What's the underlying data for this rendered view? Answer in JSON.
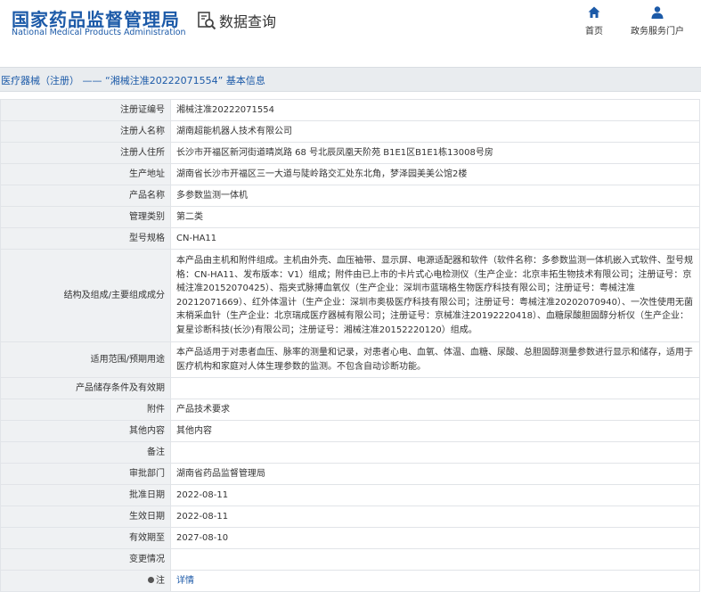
{
  "header": {
    "logo_cn": "国家药品监督管理局",
    "logo_en": "National Medical Products Administration",
    "query_title": "数据查询",
    "nav": [
      {
        "label": "首页",
        "icon": "home-icon"
      },
      {
        "label": "政务服务门户",
        "icon": "user-icon"
      }
    ]
  },
  "breadcrumb": "医疗器械（注册） —— “湘械注准20222071554” 基本信息",
  "colors": {
    "brand": "#1c5aa8",
    "label_bg": "#eff1f3",
    "bar_bg": "#e9ecef"
  },
  "rows": [
    {
      "label": "注册证编号",
      "value": "湘械注准20222071554"
    },
    {
      "label": "注册人名称",
      "value": "湖南超能机器人技术有限公司"
    },
    {
      "label": "注册人住所",
      "value": "长沙市开福区新河街道晴岚路 68 号北辰凤凰天阶苑 B1E1区B1E1栋13008号房"
    },
    {
      "label": "生产地址",
      "value": "湖南省长沙市开福区三一大道与陡岭路交汇处东北角，梦泽园美美公馆2楼"
    },
    {
      "label": "产品名称",
      "value": "多参数监测一体机"
    },
    {
      "label": "管理类别",
      "value": "第二类"
    },
    {
      "label": "型号规格",
      "value": "CN-HA11"
    },
    {
      "label": "结构及组成/主要组成成分",
      "value": "本产品由主机和附件组成。主机由外壳、血压袖带、显示屏、电源适配器和软件（软件名称：多参数监测一体机嵌入式软件、型号规格：CN-HA11、发布版本：V1）组成；附件由已上市的卡片式心电检测仪（生产企业：北京丰拓生物技术有限公司；注册证号：京械注准20152070425）、指夹式脉搏血氧仪（生产企业：深圳市蓝瑞格生物医疗科技有限公司；注册证号：粤械注准20212071669）、红外体温计（生产企业：深圳市奥极医疗科技有限公司；注册证号：粤械注准20202070940）、一次性使用无菌末梢采血针（生产企业：北京瑞成医疗器械有限公司；注册证号：京械准注20192220418）、血糖尿酸胆固醇分析仪（生产企业：复星诊断科技(长沙)有限公司；注册证号：湘械注准20152220120）组成。"
    },
    {
      "label": "适用范围/预期用途",
      "value": "本产品适用于对患者血压、脉率的测量和记录，对患者心电、血氧、体温、血糖、尿酸、总胆固醇测量参数进行显示和储存，适用于医疗机构和家庭对人体生理参数的监测。不包含自动诊断功能。"
    },
    {
      "label": "产品储存条件及有效期",
      "value": ""
    },
    {
      "label": "附件",
      "value": "产品技术要求"
    },
    {
      "label": "其他内容",
      "value": "其他内容"
    },
    {
      "label": "备注",
      "value": ""
    },
    {
      "label": "审批部门",
      "value": "湖南省药品监督管理局"
    },
    {
      "label": "批准日期",
      "value": "2022-08-11"
    },
    {
      "label": "生效日期",
      "value": "2022-08-11"
    },
    {
      "label": "有效期至",
      "value": "2027-08-10"
    },
    {
      "label": "变更情况",
      "value": ""
    },
    {
      "label": "注",
      "value": "详情"
    }
  ]
}
